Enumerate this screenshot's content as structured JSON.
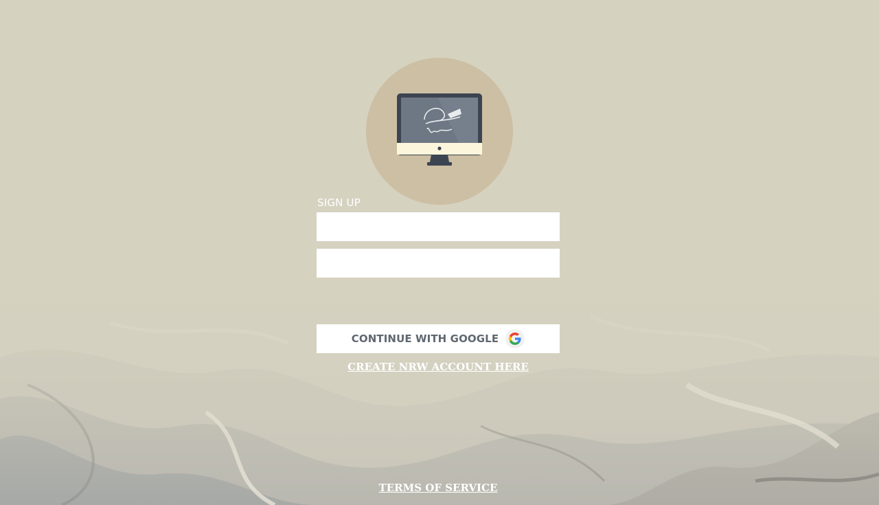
{
  "colors": {
    "background": "#d6d2c0",
    "logo_circle": "#ccbfa3",
    "text_light": "#ffffff",
    "google_text": "#5f6770"
  },
  "logo": {
    "icon": "monitor-signature-icon"
  },
  "form": {
    "heading": "SIGN UP",
    "email_placeholder": "",
    "password_placeholder": ""
  },
  "google_button": {
    "label": "CONTINUE WITH GOOGLE",
    "icon": "google-icon"
  },
  "links": {
    "create_account": "CREATE NRW ACCOUNT HERE",
    "terms": "TERMS OF SERVICE"
  }
}
